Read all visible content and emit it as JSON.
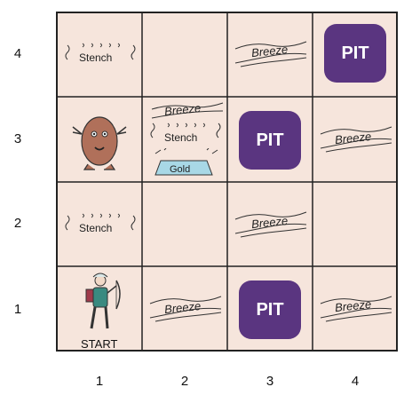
{
  "row_labels": [
    "4",
    "3",
    "2",
    "1"
  ],
  "col_labels": [
    "1",
    "2",
    "3",
    "4"
  ],
  "cells": {
    "pit_4_4": "PIT",
    "pit_3_3": "PIT",
    "pit_3_1": "PIT",
    "breeze": "Breeze",
    "stench": "Stench",
    "gold": "Gold",
    "start": "START"
  },
  "colors": {
    "cell": "#f6e5dc",
    "pit": "#5a3580",
    "wumpus": "#b0705a",
    "gold": "#a8d8e6",
    "agent": "#3a8a80"
  }
}
